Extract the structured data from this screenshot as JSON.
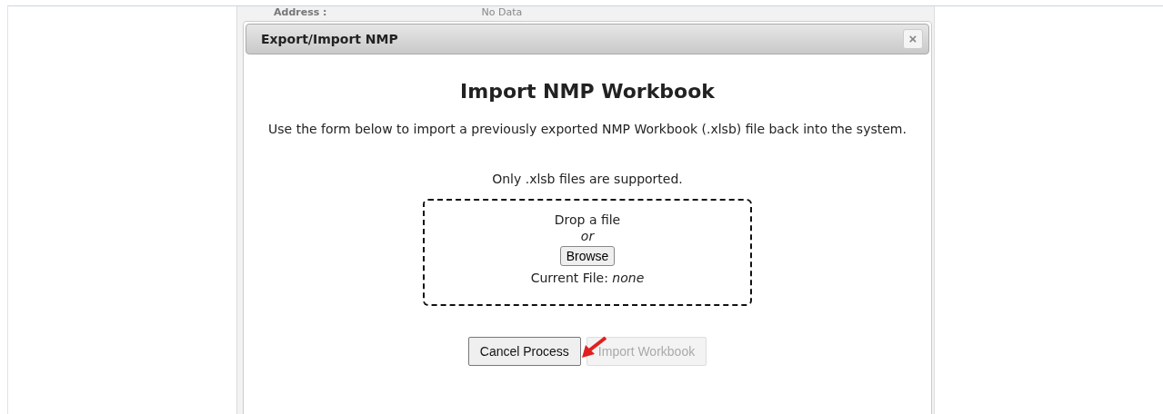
{
  "background": {
    "label": "Address :",
    "value": "No Data"
  },
  "dialog": {
    "title": "Export/Import NMP",
    "close": "×",
    "heading": "Import NMP Workbook",
    "description": "Use the form below to import a previously exported NMP Workbook (.xlsb) file back into the system.",
    "note": "Only .xlsb files are supported.",
    "dropzone": {
      "prompt": "Drop a file",
      "separator": "or",
      "browse": "Browse",
      "current_label": "Current File:",
      "current_value": "none"
    },
    "buttons": [
      {
        "label": "Cancel Process",
        "disabled": false
      },
      {
        "label": "Import Workbook",
        "disabled": true
      }
    ]
  }
}
